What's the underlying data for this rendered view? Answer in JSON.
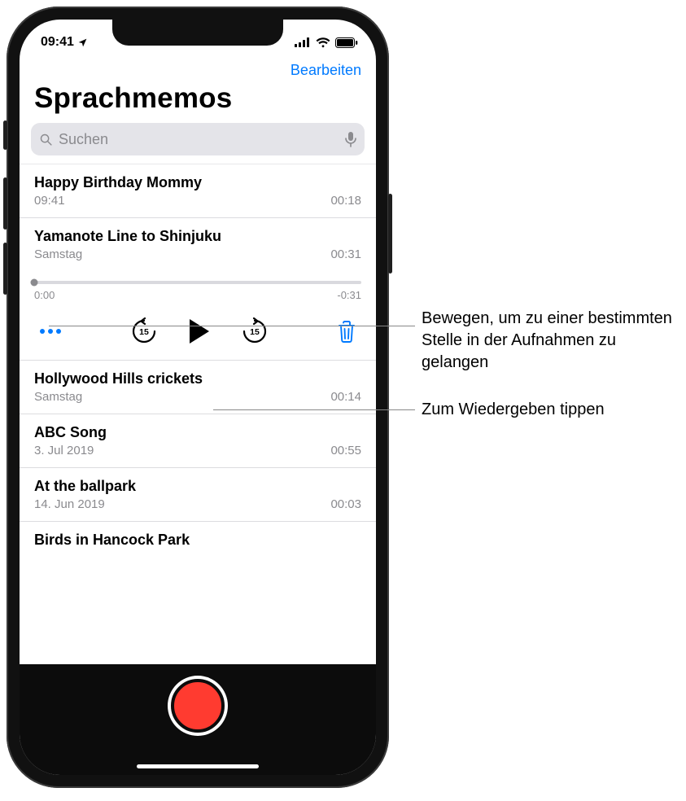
{
  "status": {
    "time": "09:41"
  },
  "nav": {
    "edit": "Bearbeiten"
  },
  "title": "Sprachmemos",
  "search": {
    "placeholder": "Suchen"
  },
  "memos": [
    {
      "title": "Happy Birthday Mommy",
      "subtitle": "09:41",
      "duration": "00:18"
    },
    {
      "title": "Yamanote Line to Shinjuku",
      "subtitle": "Samstag",
      "duration": "00:31"
    },
    {
      "title": "Hollywood Hills crickets",
      "subtitle": "Samstag",
      "duration": "00:14"
    },
    {
      "title": "ABC Song",
      "subtitle": "3. Jul 2019",
      "duration": "00:55"
    },
    {
      "title": "At the ballpark",
      "subtitle": "14. Jun 2019",
      "duration": "00:03"
    },
    {
      "title": "Birds in Hancock Park",
      "subtitle": "",
      "duration": ""
    }
  ],
  "player": {
    "position": "0:00",
    "remaining": "-0:31"
  },
  "annotations": {
    "scrub": "Bewegen, um zu einer bestimmten Stelle in der Aufnahmen zu gelangen",
    "play": "Zum Wiedergeben tippen"
  },
  "colors": {
    "accent": "#007aff",
    "record": "#ff3b30"
  }
}
